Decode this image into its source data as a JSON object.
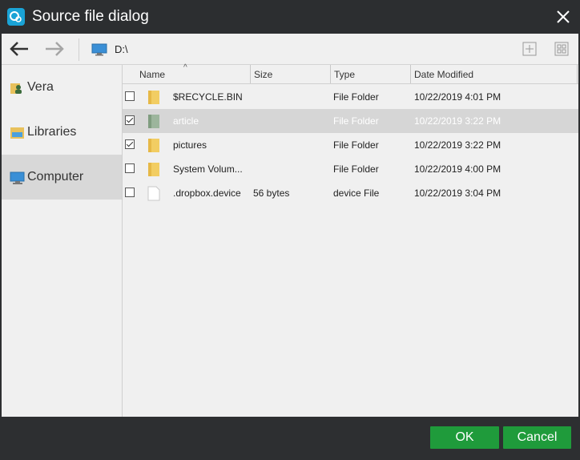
{
  "window": {
    "title": "Source file dialog"
  },
  "toolbar": {
    "path": "D:\\"
  },
  "sidebar": {
    "items": [
      {
        "label": "Vera",
        "icon": "user-folder-icon"
      },
      {
        "label": "Libraries",
        "icon": "libraries-icon"
      },
      {
        "label": "Computer",
        "icon": "computer-icon"
      }
    ],
    "selected": "Computer"
  },
  "columns": {
    "name": "Name",
    "size": "Size",
    "type": "Type",
    "date": "Date Modified"
  },
  "files": [
    {
      "name": "$RECYCLE.BIN",
      "size": "",
      "type": "File Folder",
      "date": "10/22/2019 4:01 PM",
      "checked": false,
      "icon": "folder-icon"
    },
    {
      "name": "article",
      "size": "",
      "type": "File Folder",
      "date": "10/22/2019 3:22 PM",
      "checked": true,
      "selected": true,
      "icon": "folder-icon"
    },
    {
      "name": "pictures",
      "size": "",
      "type": "File Folder",
      "date": "10/22/2019 3:22 PM",
      "checked": true,
      "icon": "folder-icon"
    },
    {
      "name": "System Volum...",
      "size": "",
      "type": "File Folder",
      "date": "10/22/2019 4:00 PM",
      "checked": false,
      "icon": "folder-icon"
    },
    {
      "name": ".dropbox.device",
      "size": "56 bytes",
      "type": "device File",
      "date": "10/22/2019 3:04 PM",
      "checked": false,
      "icon": "file-icon"
    }
  ],
  "footer": {
    "ok_label": "OK",
    "cancel_label": "Cancel"
  },
  "colors": {
    "accent_green": "#1f9b3b",
    "titlebar": "#2c2e30",
    "app_icon": "#1aa3d6"
  }
}
